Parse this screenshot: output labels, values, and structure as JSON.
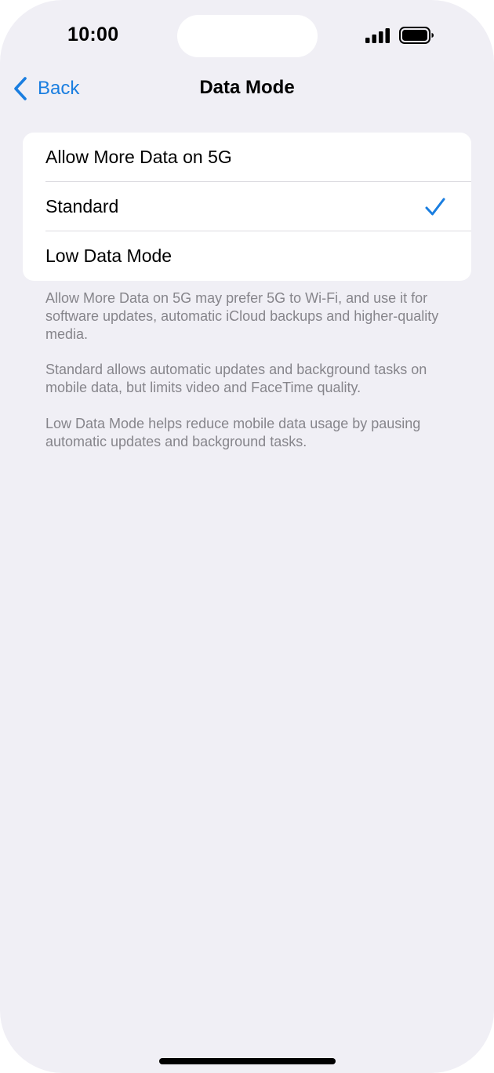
{
  "status_bar": {
    "time": "10:00",
    "signal_icon": "cellular-signal-icon",
    "battery_icon": "battery-icon"
  },
  "nav": {
    "back_label": "Back",
    "back_icon": "chevron-left-icon",
    "title": "Data Mode"
  },
  "options": [
    {
      "label": "Allow More Data on 5G",
      "selected": false
    },
    {
      "label": "Standard",
      "selected": true
    },
    {
      "label": "Low Data Mode",
      "selected": false
    }
  ],
  "descriptions": [
    "Allow More Data on 5G may prefer 5G to Wi-Fi, and use it for software updates, automatic iCloud backups and higher-quality media.",
    "Standard allows automatic updates and background tasks on mobile data, but limits video and FaceTime quality.",
    "Low Data Mode helps reduce mobile data usage by pausing automatic updates and background tasks."
  ],
  "colors": {
    "accent": "#1a7ee0",
    "background": "#f0eff5",
    "secondary_text": "#86858b"
  }
}
